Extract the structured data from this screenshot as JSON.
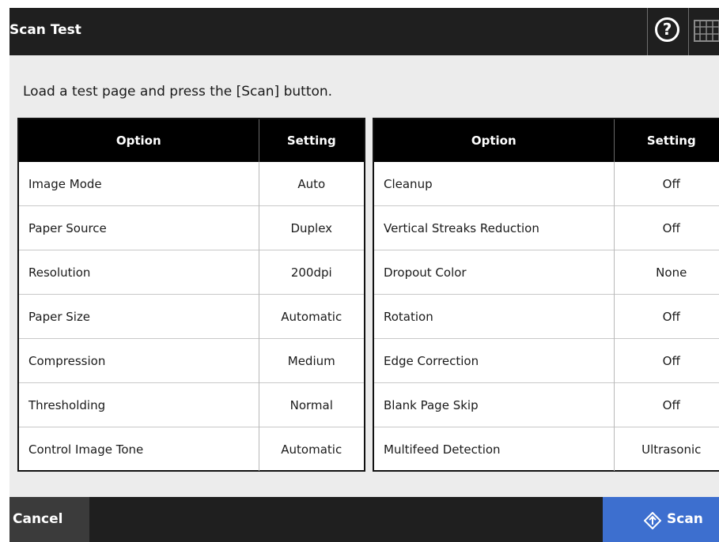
{
  "header": {
    "title": "Scan Test",
    "help_icon_glyph": "?",
    "help_icon": "help-circle-icon",
    "keyboard_icon": "keyboard-icon"
  },
  "instruction": "Load a test page and press the [Scan] button.",
  "left_table": {
    "headers": [
      "Option",
      "Setting"
    ],
    "rows": [
      [
        "Image Mode",
        "Auto"
      ],
      [
        "Paper Source",
        "Duplex"
      ],
      [
        "Resolution",
        "200dpi"
      ],
      [
        "Paper Size",
        "Automatic"
      ],
      [
        "Compression",
        "Medium"
      ],
      [
        "Thresholding",
        "Normal"
      ],
      [
        "Control Image Tone",
        "Automatic"
      ]
    ]
  },
  "right_table": {
    "headers": [
      "Option",
      "Setting"
    ],
    "rows": [
      [
        "Cleanup",
        "Off"
      ],
      [
        "Vertical Streaks Reduction",
        "Off"
      ],
      [
        "Dropout Color",
        "None"
      ],
      [
        "Rotation",
        "Off"
      ],
      [
        "Edge Correction",
        "Off"
      ],
      [
        "Blank Page Skip",
        "Off"
      ],
      [
        "Multifeed Detection",
        "Ultrasonic"
      ]
    ]
  },
  "footer": {
    "cancel_label": "Cancel",
    "scan_label": "Scan",
    "scan_icon": "scan-diamond-icon"
  },
  "colors": {
    "header_bg": "#1f1f1f",
    "scan_accent": "#3d6fcf",
    "cancel_bg": "#3b3b3b"
  }
}
